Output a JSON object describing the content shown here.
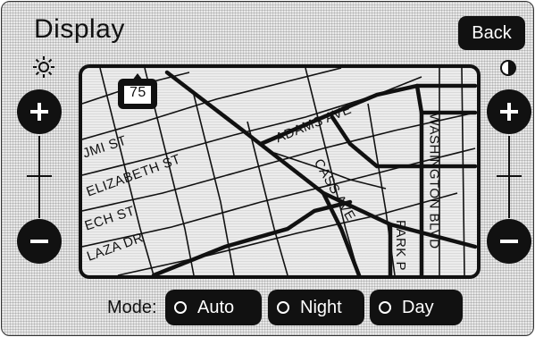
{
  "header": {
    "title": "Display",
    "back_label": "Back"
  },
  "brightness": {
    "icon": "sun-icon",
    "increase_icon": "plus-icon",
    "decrease_icon": "minus-icon"
  },
  "contrast": {
    "icon": "half-circle-icon",
    "increase_icon": "plus-icon",
    "decrease_icon": "minus-icon"
  },
  "map": {
    "highway_shield": "75",
    "streets": [
      "ADAMS AVE",
      "JMI ST",
      "ELIZABETH ST",
      "CASS AVE",
      "WASHINGTON BLVD",
      "ECH ST",
      "LAZA DR",
      "PARK P"
    ]
  },
  "mode": {
    "label": "Mode:",
    "options": [
      "Auto",
      "Night",
      "Day"
    ]
  },
  "colors": {
    "button_bg": "#111111",
    "button_text": "#ffffff",
    "screen_bg": "#e9e9e9"
  }
}
